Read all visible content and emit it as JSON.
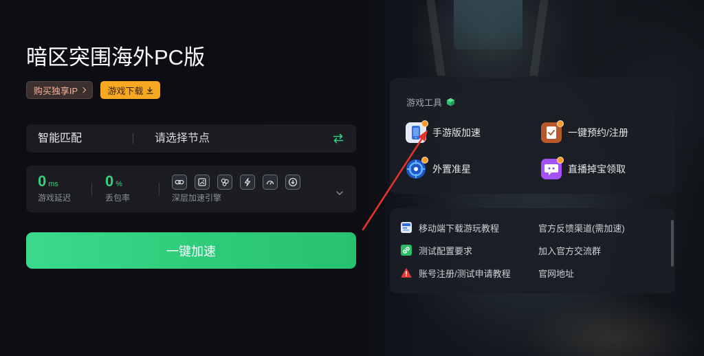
{
  "header": {
    "title": "暗区突围海外PC版",
    "buy_ip_button": {
      "label": "购买独享IP",
      "icon": "chevron-right-icon"
    },
    "download_button": {
      "label": "游戏下载",
      "icon": "download-icon"
    }
  },
  "node_selector": {
    "mode_label": "智能匹配",
    "node_label": "请选择节点",
    "switch_icon": "swap-icon"
  },
  "stats": {
    "latency": {
      "value": "0",
      "unit": "ms",
      "label": "游戏延迟"
    },
    "packet_loss": {
      "value": "0",
      "unit": "%",
      "label": "丢包率"
    },
    "engine": {
      "label": "深层加速引擎",
      "icons": [
        "loop-icon",
        "image-icon",
        "circles-icon",
        "bolt-icon",
        "gauge-icon",
        "download-circle-icon"
      ]
    },
    "expand_icon": "chevron-down-icon"
  },
  "accelerate_button": {
    "label": "一键加速"
  },
  "tools": {
    "title": "游戏工具",
    "title_icon": "cube-icon",
    "items": [
      {
        "label": "手游版加速",
        "icon": "phone-icon"
      },
      {
        "label": "一键预约/注册",
        "icon": "register-icon"
      },
      {
        "label": "外置准星",
        "icon": "crosshair-icon"
      },
      {
        "label": "直播掉宝领取",
        "icon": "live-gift-icon"
      }
    ]
  },
  "links": {
    "items": [
      {
        "label": "移动端下载游玩教程",
        "icon": "tutorial-icon"
      },
      {
        "label": "官方反馈渠道(需加速)"
      },
      {
        "label": "测试配置要求",
        "icon": "link-icon"
      },
      {
        "label": "加入官方交流群"
      },
      {
        "label": "账号注册/测试申请教程",
        "icon": "warning-icon"
      },
      {
        "label": "官网地址"
      }
    ]
  },
  "colors": {
    "background": "#0d0f14",
    "accent_green": "#33d17f",
    "download_orange": "#f7a823",
    "buy_ip_text": "#f4b39b",
    "annotation_red": "#e4332b"
  }
}
